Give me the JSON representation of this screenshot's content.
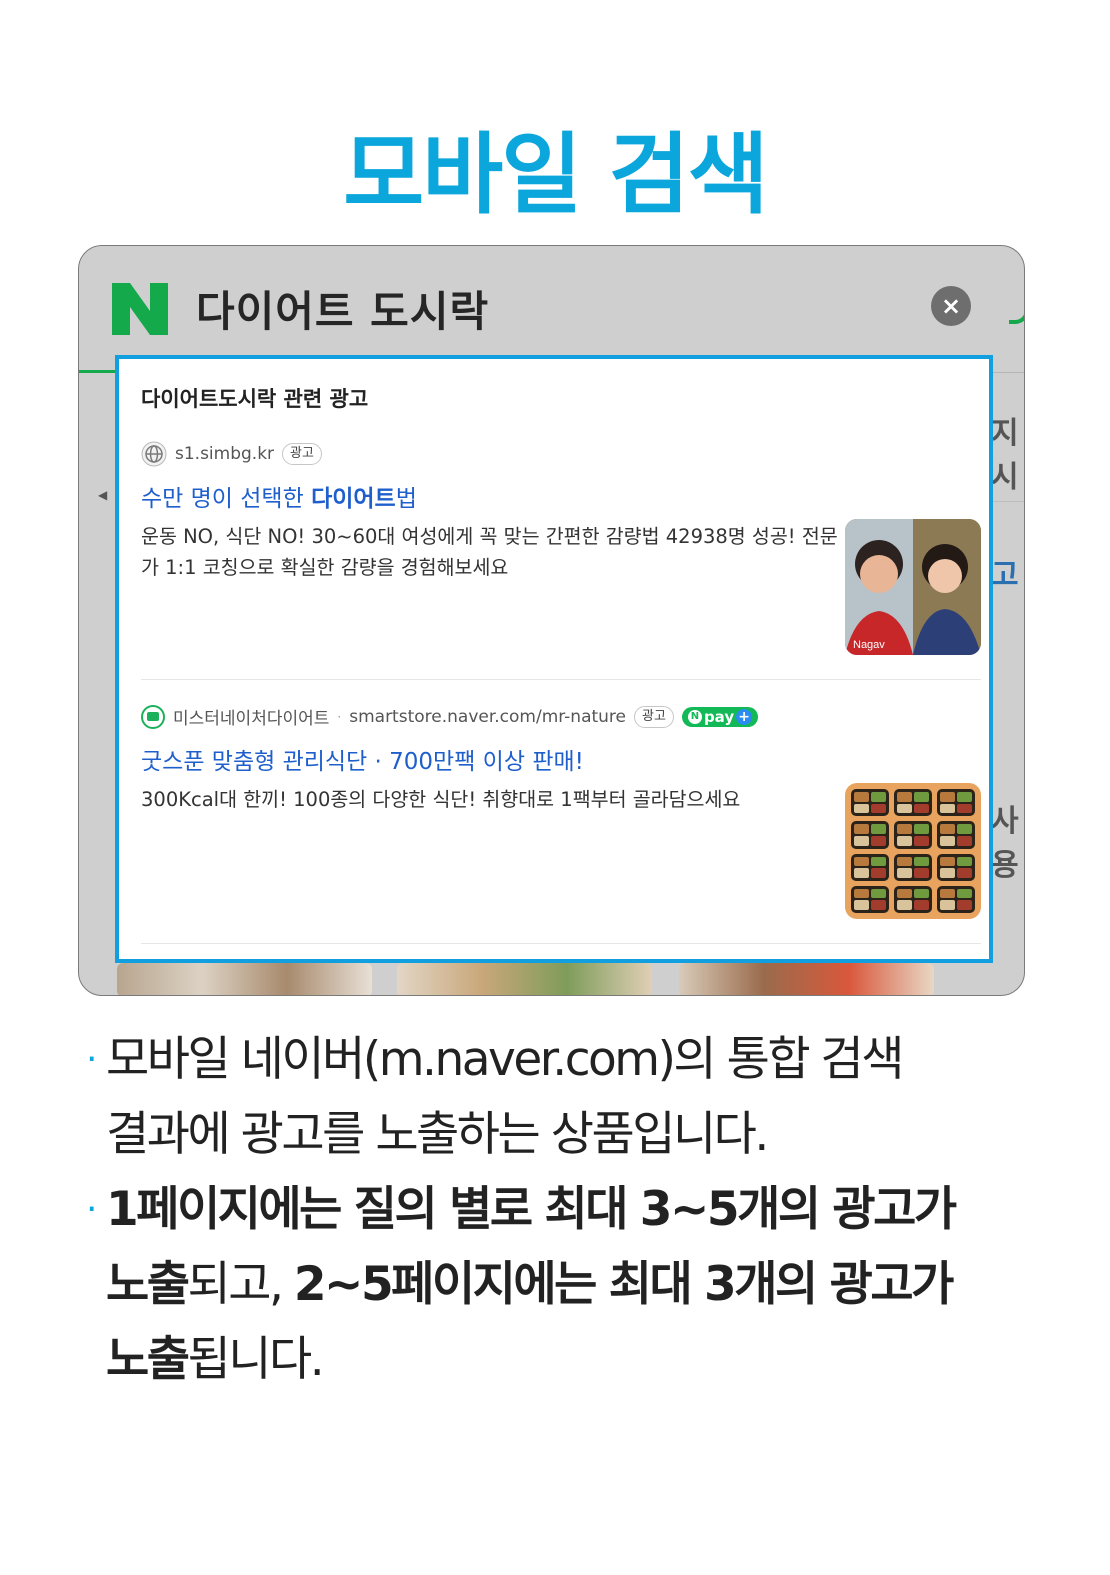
{
  "page": {
    "title": "모바일 검색"
  },
  "search_bar": {
    "logo_letter": "N",
    "query": "다이어트 도시락",
    "clear_symbol": "×"
  },
  "background_fragments": [
    "지시",
    "고",
    "사용"
  ],
  "ad_panel": {
    "heading": "다이어트도시락 관련 광고",
    "ads": [
      {
        "domain": "s1.simbg.kr",
        "badge": "광고",
        "title_pre": "수만 명이 선택한 ",
        "title_bold": "다이어트",
        "title_post": "법",
        "description": "운동 NO, 식단 NO! 30~60대 여성에게 꼭 맞는 간편한 감량법 42938명 성공! 전문가 1:1 코칭으로 확실한 감량을 경험해보세요",
        "thumbnail_text": "Nagav",
        "icon": "globe-icon"
      },
      {
        "store_name": "미스터네이처다이어트",
        "separator": "·",
        "domain": "smartstore.naver.com/mr-nature",
        "badge": "광고",
        "npay_label": "pay",
        "npay_n": "N",
        "npay_plus": "+",
        "title": "굿스푼 맞춤형 관리식단 · 700만팩 이상 판매!",
        "description": "300Kcal대 한끼! 100종의 다양한 식단! 취향대로 1팩부터 골라담으세요",
        "icon": "store-icon"
      }
    ]
  },
  "bullets": [
    {
      "dot": "·",
      "line1": "모바일 네이버(m.naver.com)의 통합 검색",
      "line2": "결과에 광고를 노출하는 상품입니다."
    },
    {
      "dot": "·",
      "line1_bold": "1페이지에는 질의 별로 최대 3~5개의 광고가",
      "line2_bold_a": "노출",
      "line2_normal": "되고, ",
      "line2_bold_b": "2~5페이지에는 최대 3개의 광고가",
      "line3_bold": "노출",
      "line3_normal": "됩니다."
    }
  ],
  "colors": {
    "title_blue": "#0aa6dc",
    "panel_border": "#119fe0",
    "ad_link": "#1f5fcc",
    "naver_green": "#14a94b"
  }
}
